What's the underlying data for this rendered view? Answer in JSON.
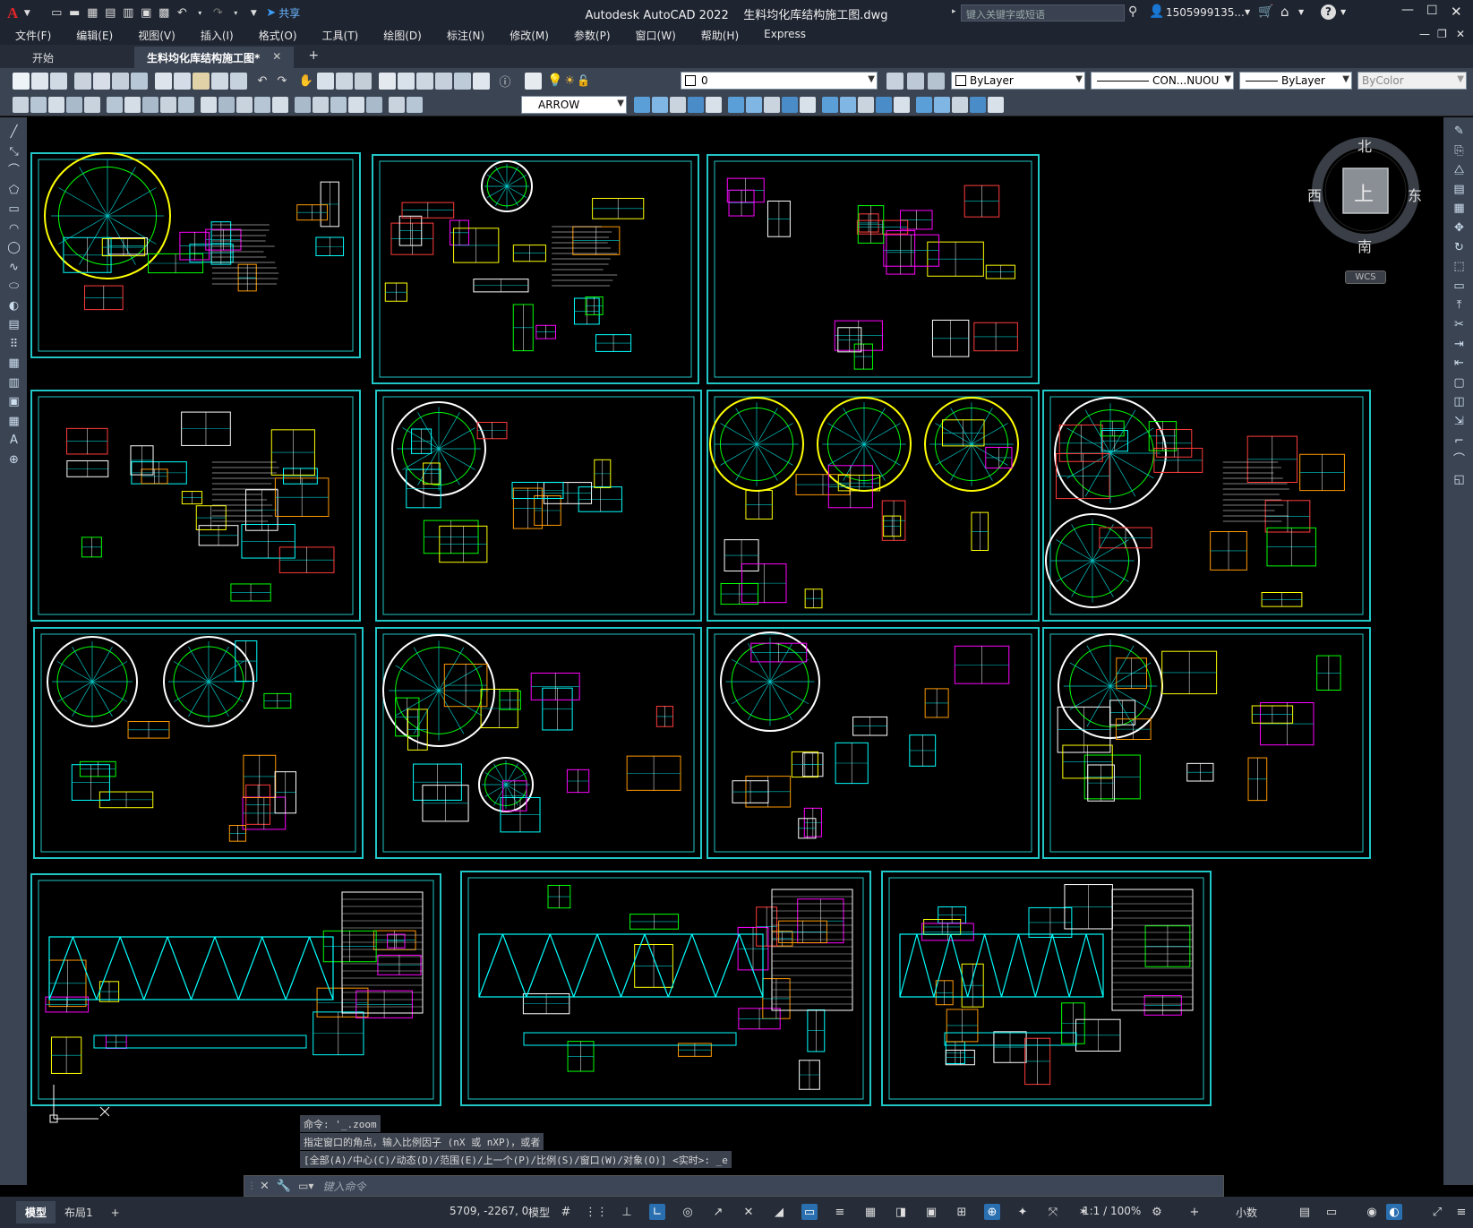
{
  "app": {
    "logo": "A",
    "title": "Autodesk AutoCAD 2022    生料均化库结构施工图.dwg",
    "share": "共享",
    "search_placeholder": "键入关键字或短语",
    "user": "1505999135...",
    "help": "?"
  },
  "menu": [
    "文件(F)",
    "编辑(E)",
    "视图(V)",
    "插入(I)",
    "格式(O)",
    "工具(T)",
    "绘图(D)",
    "标注(N)",
    "修改(M)",
    "参数(P)",
    "窗口(W)",
    "帮助(H)",
    "Express"
  ],
  "tabs": {
    "start": "开始",
    "doc": "生料均化库结构施工图*",
    "close": "✕",
    "add": "+"
  },
  "toolbar": {
    "layer_value": "0",
    "color": "ByLayer",
    "linetype": "CON...NUOU",
    "lineweight": "ByLayer",
    "plotstyle": "ByColor",
    "dimstyle": "ARROW"
  },
  "viewcube": {
    "north": "北",
    "south": "南",
    "east": "东",
    "west": "西",
    "top": "上",
    "wcs": "WCS"
  },
  "command": {
    "history": [
      "命令: '_.zoom",
      "指定窗口的角点，输入比例因子 (nX 或 nXP)，或者",
      "[全部(A)/中心(C)/动态(D)/范围(E)/上一个(P)/比例(S)/窗口(W)/对象(O)] <实时>: _e"
    ],
    "placeholder": "键入命令"
  },
  "status": {
    "model_tab": "模型",
    "layout_tab": "布局1",
    "add": "+",
    "coords": "5709, -2267, 0",
    "space": "模型",
    "scale": "1:1 / 100%",
    "units": "小数"
  },
  "colors": {
    "sheet_border": "#21c6c6",
    "background": "#000000",
    "ui_dark": "#1e2430",
    "ui_panel": "#3b4453"
  }
}
